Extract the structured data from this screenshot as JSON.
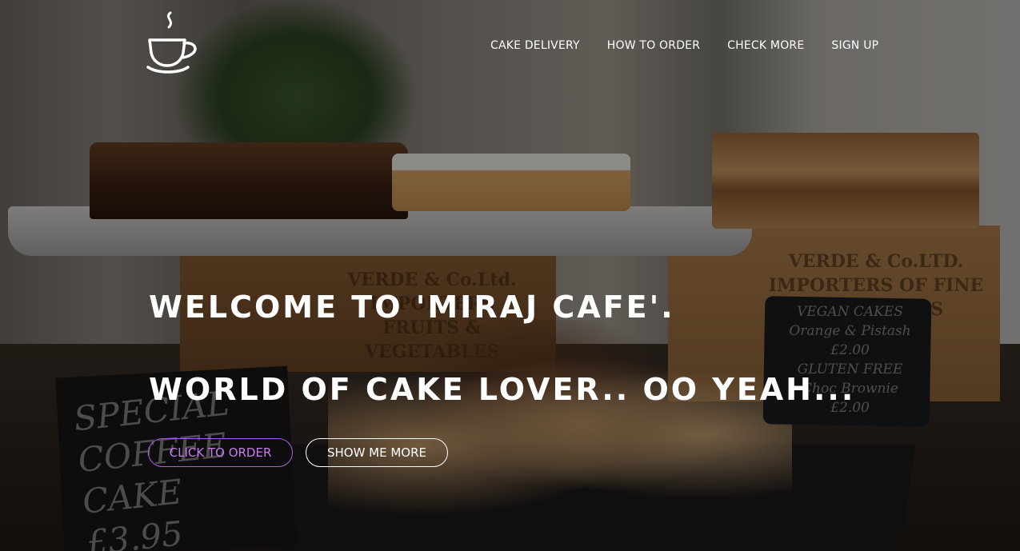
{
  "logo": {
    "icon": "coffee-cup-icon"
  },
  "nav": {
    "items": [
      {
        "label": "CAKE DELIVERY"
      },
      {
        "label": "HOW TO ORDER"
      },
      {
        "label": "CHECK MORE"
      },
      {
        "label": "SIGN UP"
      }
    ]
  },
  "hero": {
    "line1": "WELCOME TO 'MIRAJ CAFE'.",
    "line2": "WORLD OF CAKE LOVER.. OO YEAH...",
    "order_button": "CLICK TO ORDER",
    "more_button": "SHOW ME MORE"
  },
  "photo_signs": {
    "chalkboard_left": "SPECIAL\nCOFFEE\nCAKE £3.95",
    "chalkboard_right": "VEGAN CAKES\nOrange & Pistash\n£2.00\nGLUTEN FREE\nChoc Brownie\n£2.00",
    "crate_left": "VERDE & Co.Ltd.\nIMPORTERS\nFRUITS & VEGETABLES",
    "crate_right": "VERDE & Co.LTD.\nIMPORTERS OF FINE\nVEGETABLES\nSTREET"
  },
  "colors": {
    "accent": "#c77bf0",
    "accent_border": "#b15ce0",
    "text": "#ffffff",
    "overlay": "rgba(0,0,0,0.42)"
  }
}
